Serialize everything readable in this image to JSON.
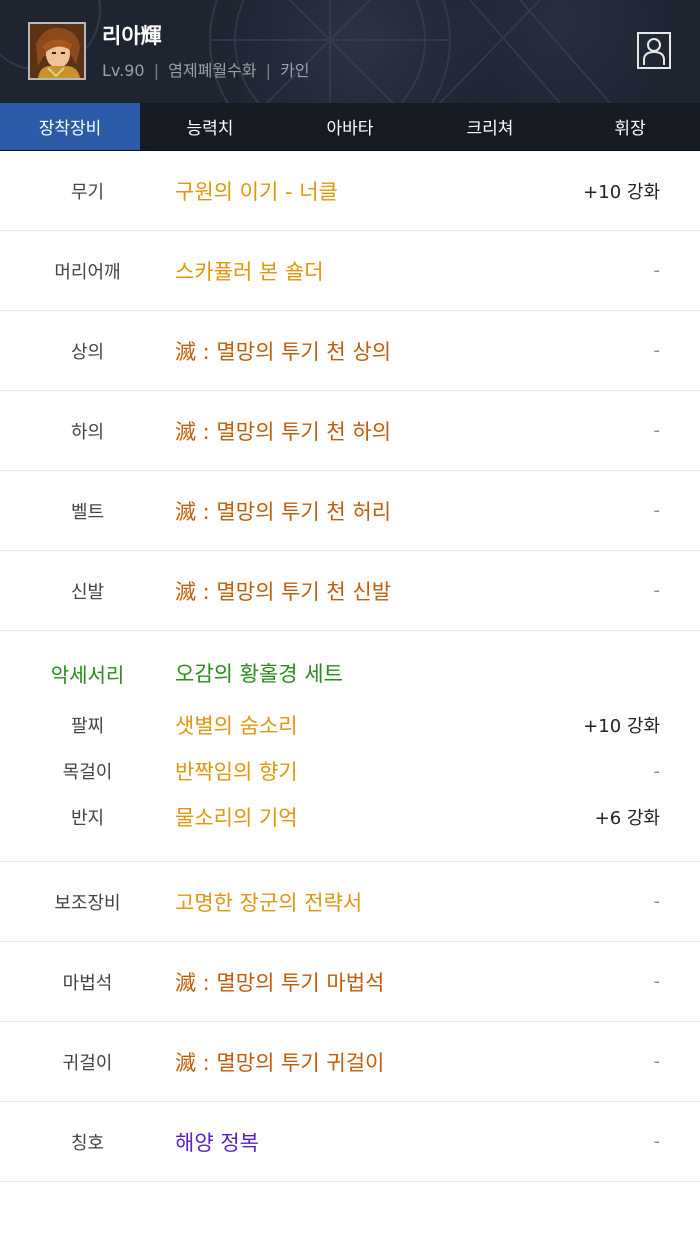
{
  "character": {
    "name": "리아輝",
    "level": "Lv.90",
    "guild": "염제폐월수화",
    "server": "카인",
    "separator": "|"
  },
  "tabs": [
    {
      "label": "장착장비",
      "active": true
    },
    {
      "label": "능력치",
      "active": false
    },
    {
      "label": "아바타",
      "active": false
    },
    {
      "label": "크리쳐",
      "active": false
    },
    {
      "label": "휘장",
      "active": false
    }
  ],
  "equipment": [
    {
      "slot": "무기",
      "item": "구원의 이기 - 너클",
      "enhance": "+10 강화",
      "rarity": "gold"
    },
    {
      "slot": "머리어깨",
      "item": "스카퓰러 본 숄더",
      "enhance": "-",
      "rarity": "gold"
    },
    {
      "slot": "상의",
      "item": "滅 : 멸망의 투기 천 상의",
      "enhance": "-",
      "rarity": "epic"
    },
    {
      "slot": "하의",
      "item": "滅 : 멸망의 투기 천 하의",
      "enhance": "-",
      "rarity": "epic"
    },
    {
      "slot": "벨트",
      "item": "滅 : 멸망의 투기 천 허리",
      "enhance": "-",
      "rarity": "epic"
    },
    {
      "slot": "신발",
      "item": "滅 : 멸망의 투기 천 신발",
      "enhance": "-",
      "rarity": "epic"
    }
  ],
  "accessory": {
    "label": "악세서리",
    "set_name": "오감의 황홀경 세트",
    "items": [
      {
        "slot": "팔찌",
        "item": "샛별의 숨소리",
        "enhance": "+10 강화"
      },
      {
        "slot": "목걸이",
        "item": "반짝임의 향기",
        "enhance": "-"
      },
      {
        "slot": "반지",
        "item": "물소리의 기억",
        "enhance": "+6 강화"
      }
    ]
  },
  "equipment2": [
    {
      "slot": "보조장비",
      "item": "고명한 장군의 전략서",
      "enhance": "-",
      "rarity": "gold"
    },
    {
      "slot": "마법석",
      "item": "滅 : 멸망의 투기 마법석",
      "enhance": "-",
      "rarity": "epic"
    },
    {
      "slot": "귀걸이",
      "item": "滅 : 멸망의 투기 귀걸이",
      "enhance": "-",
      "rarity": "epic"
    },
    {
      "slot": "칭호",
      "item": "해양 정복",
      "enhance": "-",
      "rarity": "purple"
    }
  ],
  "colors": {
    "header_bg": "#1e2430",
    "tab_active": "#2b5ba8",
    "gold": "#e0960d",
    "epic": "#c15d0b",
    "purple": "#5a21c8",
    "set_green": "#2a8a1c"
  },
  "icons": {
    "avatar": "character-portrait",
    "profile": "person-icon"
  }
}
